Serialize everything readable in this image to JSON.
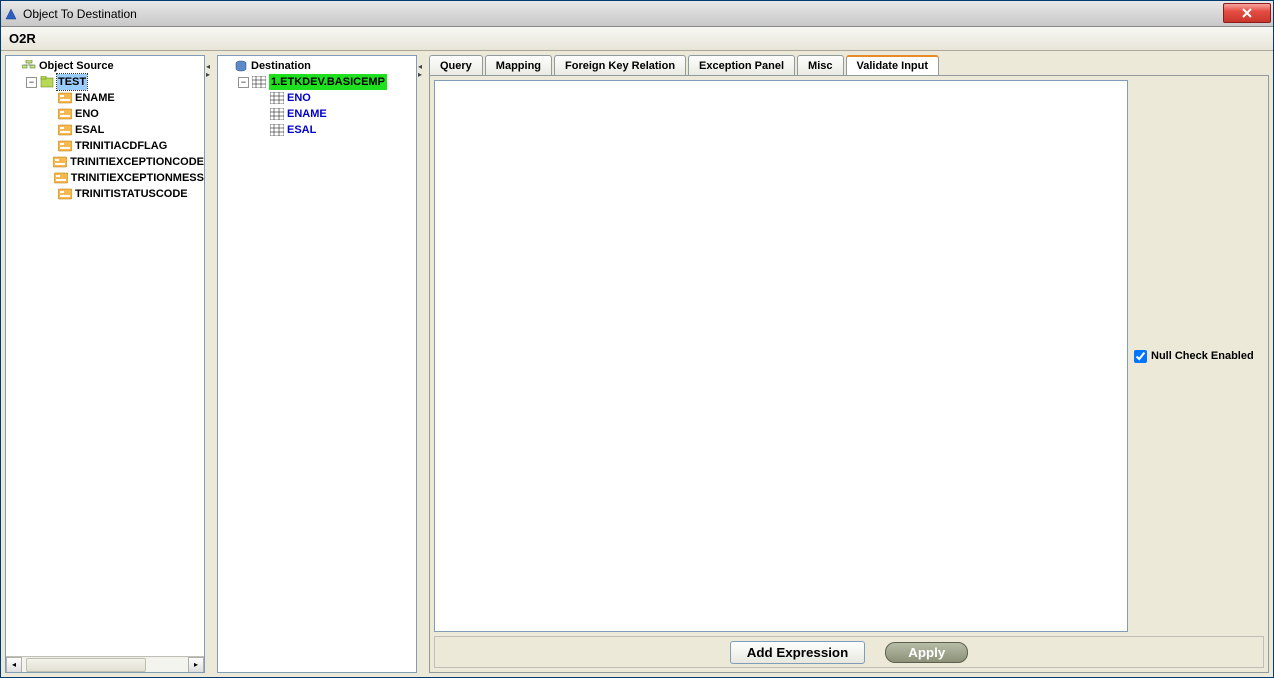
{
  "window": {
    "title": "Object To Destination"
  },
  "subheader": {
    "label": "O2R"
  },
  "sourceTree": {
    "root": "Object Source",
    "node": "TEST",
    "fields": [
      "ENAME",
      "ENO",
      "ESAL",
      "TRINITIACDFLAG",
      "TRINITIEXCEPTIONCODE",
      "TRINITIEXCEPTIONMESS",
      "TRINITISTATUSCODE"
    ]
  },
  "destTree": {
    "root": "Destination",
    "node": "1.ETKDEV.BASICEMP",
    "fields": [
      "ENO",
      "ENAME",
      "ESAL"
    ]
  },
  "tabs": [
    "Query",
    "Mapping",
    "Foreign Key Relation",
    "Exception Panel",
    "Misc",
    "Validate Input"
  ],
  "activeTab": "Validate Input",
  "nullCheck": {
    "label": "Null Check Enabled",
    "checked": true
  },
  "buttons": {
    "add": "Add Expression",
    "apply": "Apply"
  }
}
